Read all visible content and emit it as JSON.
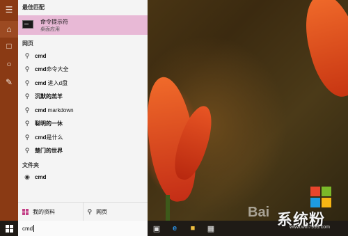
{
  "best_match": {
    "section_label": "最佳匹配",
    "title": "命令提示符",
    "subtitle": "桌面应用"
  },
  "web": {
    "section_label": "网页",
    "items": [
      {
        "bold": "cmd",
        "rest": ""
      },
      {
        "bold": "cmd",
        "rest": "命令大全"
      },
      {
        "bold": "cmd",
        "rest": " 进入d盘"
      },
      {
        "bold": "",
        "rest": "沉默的羔羊"
      },
      {
        "bold": "cmd",
        "rest": " markdown"
      },
      {
        "bold": "",
        "rest": "聪明的一休"
      },
      {
        "bold": "cmd",
        "rest": "是什么"
      },
      {
        "bold": "",
        "rest": "楚门的世界"
      }
    ]
  },
  "folders": {
    "section_label": "文件夹",
    "items": [
      {
        "bold": "cmd",
        "rest": ""
      }
    ]
  },
  "bottom": {
    "my_stuff": "我的资料",
    "web": "网页"
  },
  "search": {
    "value": "cmd"
  },
  "watermark": {
    "brand": "系统粉",
    "url": "www.win7999.com",
    "baidu": "Bai"
  },
  "colors": {
    "accent_rail": "#8a3a14",
    "highlight": "#e8b9d6"
  }
}
